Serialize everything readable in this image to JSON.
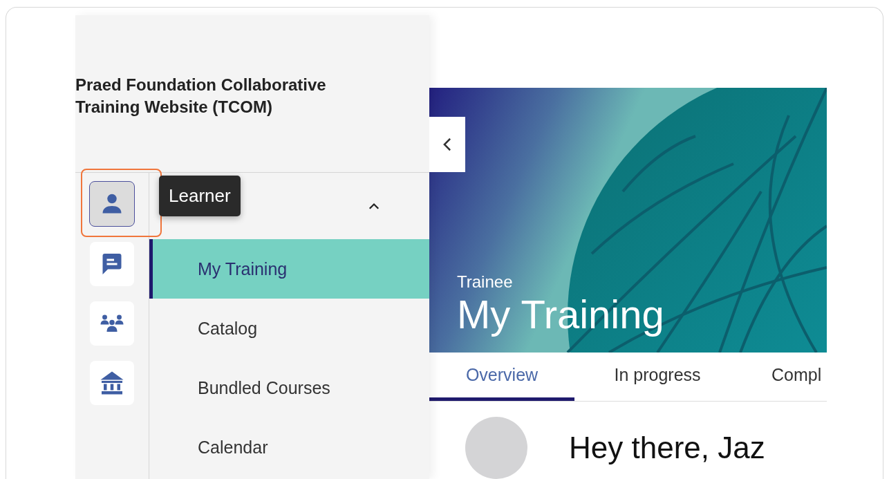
{
  "site_title": "Praed Foundation Collaborative Training Website (TCOM)",
  "rail": [
    {
      "kind": "person",
      "selected": true
    },
    {
      "kind": "chat",
      "selected": false
    },
    {
      "kind": "group",
      "selected": false
    },
    {
      "kind": "bank",
      "selected": false
    }
  ],
  "tooltip": {
    "label": "Learner"
  },
  "menu": {
    "expanded": true,
    "items": [
      {
        "label": "My Training",
        "selected": true
      },
      {
        "label": "Catalog",
        "selected": false
      },
      {
        "label": "Bundled Courses",
        "selected": false
      },
      {
        "label": "Calendar",
        "selected": false
      }
    ]
  },
  "banner": {
    "eyebrow": "Trainee",
    "title": "My Training"
  },
  "tabs": [
    {
      "label": "Overview",
      "selected": true
    },
    {
      "label": "In progress",
      "selected": false
    },
    {
      "label": "Compl",
      "selected": false
    }
  ],
  "greeting": "Hey there, Jaz"
}
